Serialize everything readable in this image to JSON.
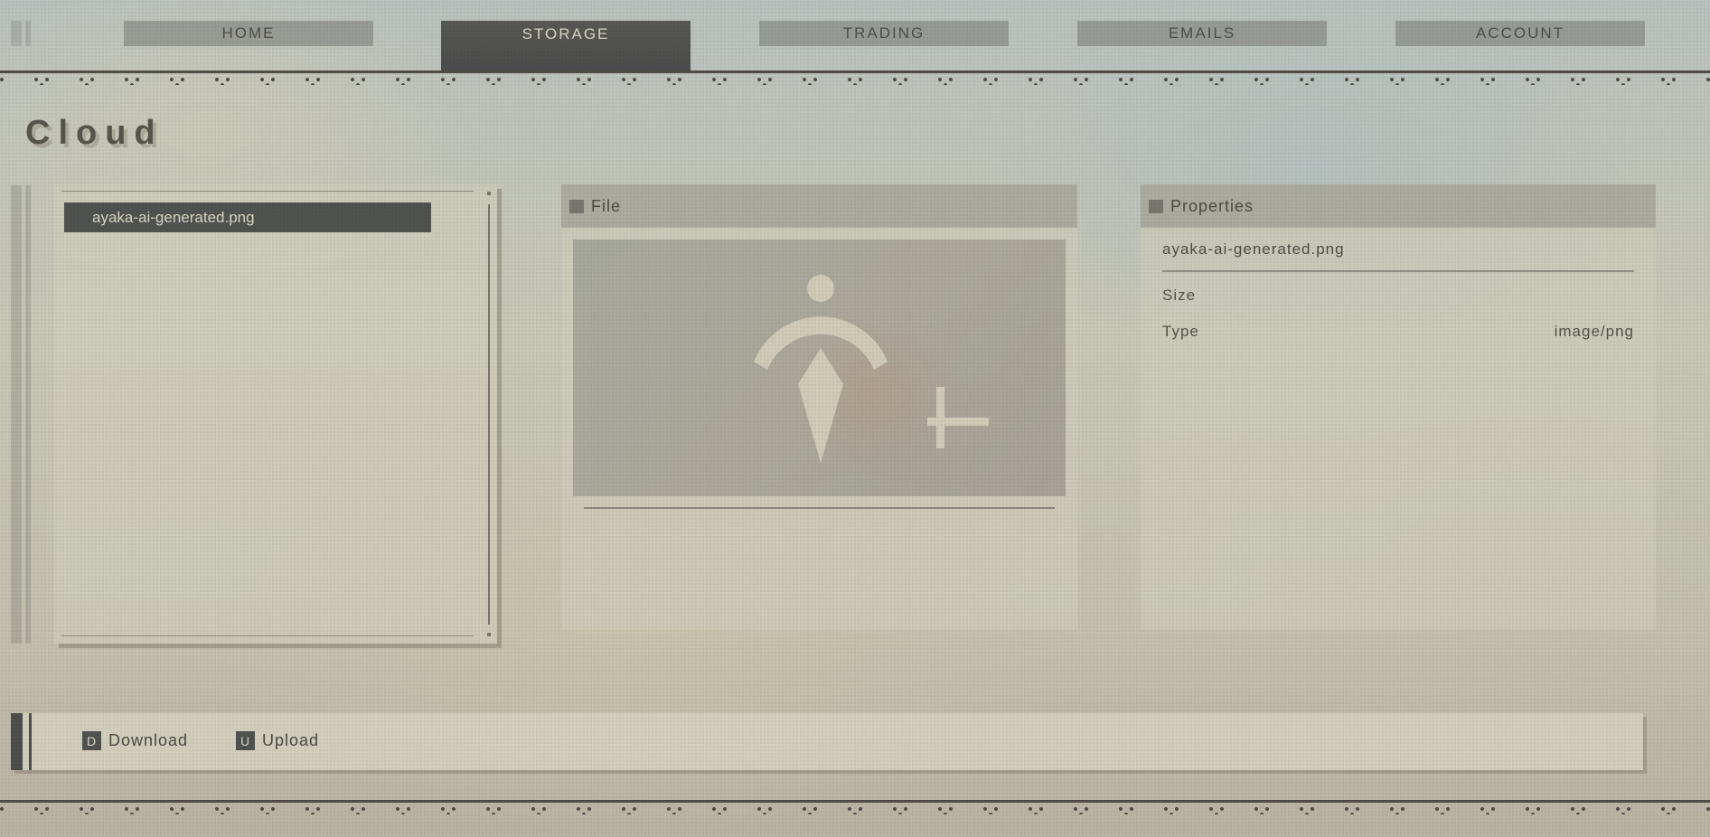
{
  "nav": {
    "tabs": [
      {
        "label": "HOME"
      },
      {
        "label": "STORAGE",
        "active": true
      },
      {
        "label": "TRADING"
      },
      {
        "label": "EMAILS"
      },
      {
        "label": "ACCOUNT"
      }
    ]
  },
  "page": {
    "title": "Cloud"
  },
  "file_list": {
    "items": [
      {
        "name": "ayaka-ai-generated.png",
        "selected": true
      }
    ]
  },
  "file_panel": {
    "title": "File",
    "preview_icon": "add-image-placeholder-icon"
  },
  "properties": {
    "title": "Properties",
    "filename": "ayaka-ai-generated.png",
    "rows": [
      {
        "label": "Size",
        "value": ""
      },
      {
        "label": "Type",
        "value": "image/png"
      }
    ]
  },
  "actions": {
    "download": {
      "key": "D",
      "label": "Download"
    },
    "upload": {
      "key": "U",
      "label": "Upload"
    }
  },
  "colors": {
    "accent_dark": "#4f524f",
    "text": "#4a4740",
    "panel": "#cdcbb8"
  }
}
